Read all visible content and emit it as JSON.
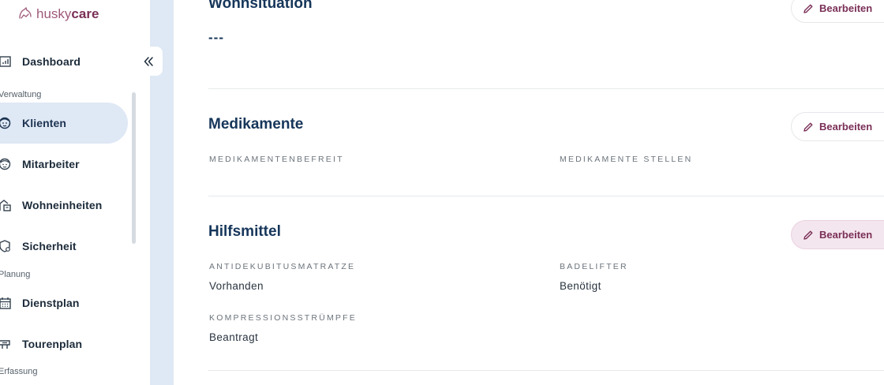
{
  "brand": {
    "husky": "husky",
    "care": "care"
  },
  "sidebar": {
    "items": [
      {
        "label": "Dashboard",
        "icon": "dashboard-icon"
      },
      {
        "label": "Klienten",
        "icon": "client-face-icon",
        "active": true
      },
      {
        "label": "Mitarbeiter",
        "icon": "employee-face-icon"
      },
      {
        "label": "Wohneinheiten",
        "icon": "housing-unit-icon"
      },
      {
        "label": "Sicherheit",
        "icon": "shield-icon"
      },
      {
        "label": "Dienstplan",
        "icon": "calendar-icon"
      },
      {
        "label": "Tourenplan",
        "icon": "route-sign-icon"
      }
    ],
    "sections": [
      "Verwaltung",
      "Planung",
      "Erfassung"
    ]
  },
  "main": {
    "wohnsituation": {
      "title": "Wohnsituation",
      "value": "---",
      "edit_label": "Bearbeiten"
    },
    "medikamente": {
      "title": "Medikamente",
      "edit_label": "Bearbeiten",
      "fields": [
        {
          "label": "Medikamentenbefreit",
          "value": ""
        },
        {
          "label": "Medikamente stellen",
          "value": ""
        }
      ]
    },
    "hilfsmittel": {
      "title": "Hilfsmittel",
      "edit_label": "Bearbeiten",
      "fields": [
        {
          "label": "Antidekubitusmatratze",
          "value": "Vorhanden"
        },
        {
          "label": "Badelifter",
          "value": "Benötigt"
        },
        {
          "label": "Kompressionsstrümpfe",
          "value": "Beantragt"
        }
      ]
    }
  },
  "colors": {
    "accent": "#7a2f57",
    "active_nav_bg": "#dfe8f5",
    "heading": "#16365a"
  }
}
